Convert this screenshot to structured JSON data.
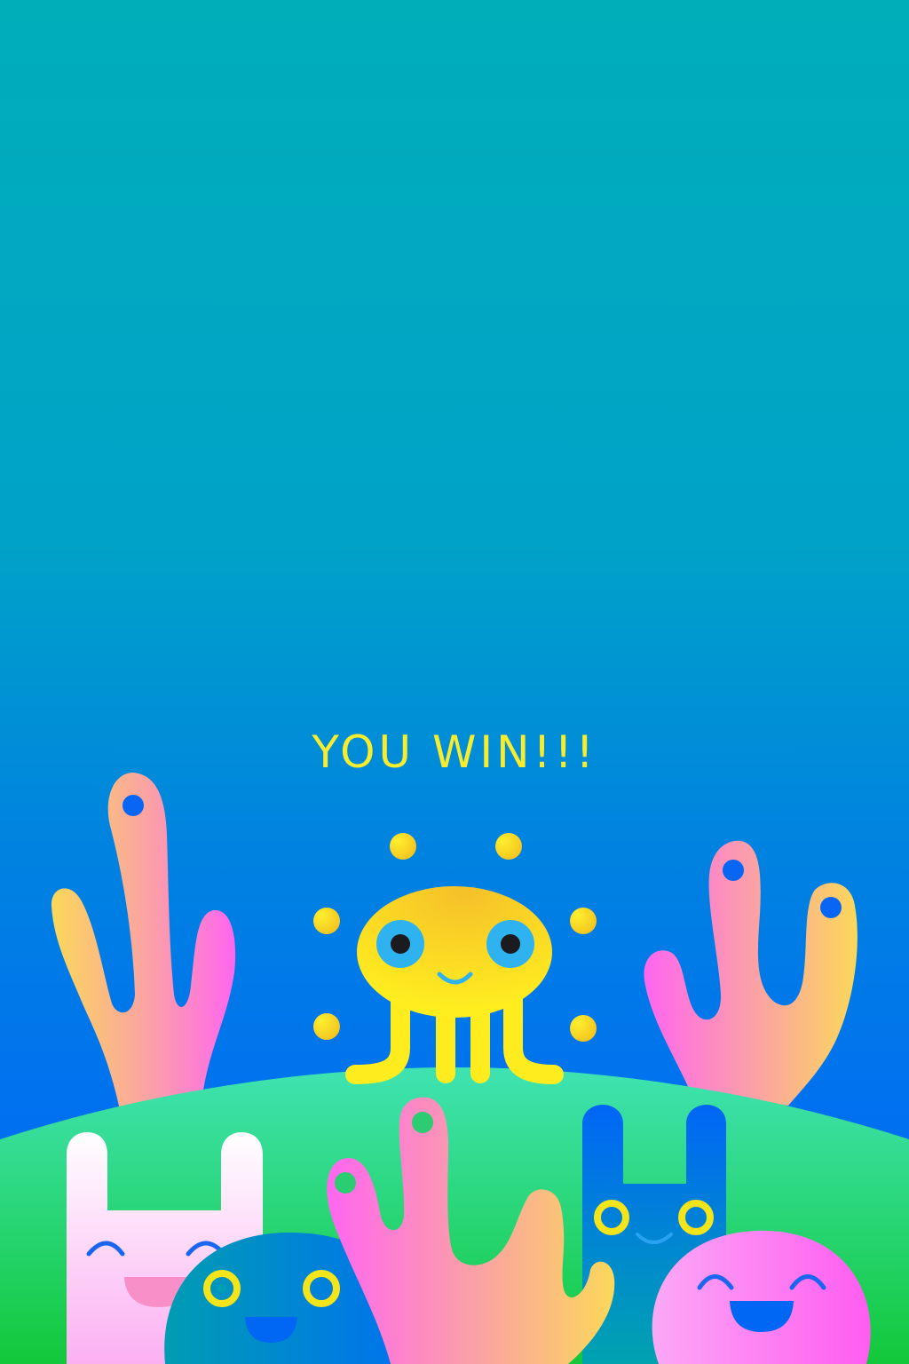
{
  "screen": {
    "title": "YOU WIN!!!"
  },
  "colors": {
    "sky_top": "#00AEBA",
    "sky_bottom": "#0070EE",
    "title": "#F7EC2E",
    "hill_top": "#3FE3B2",
    "hill_bottom": "#13C83A",
    "coral_yellow": "#FBD85A",
    "coral_pink": "#FF66F0",
    "octopus": "#FFE61F",
    "octopus_eye": "#29B6F0",
    "monster_blue": "#0066F5",
    "monster_teal": "#009FB5",
    "monster_pink": "#FF77F2"
  },
  "characters": [
    {
      "name": "yellow-octopus",
      "icon": "octopus-icon"
    },
    {
      "name": "white-bunny-monster",
      "icon": "bunny-icon"
    },
    {
      "name": "teal-blob-monster",
      "icon": "blob-icon"
    },
    {
      "name": "blue-bunny-monster",
      "icon": "bunny-icon"
    },
    {
      "name": "pink-blob-monster",
      "icon": "blob-icon"
    }
  ]
}
